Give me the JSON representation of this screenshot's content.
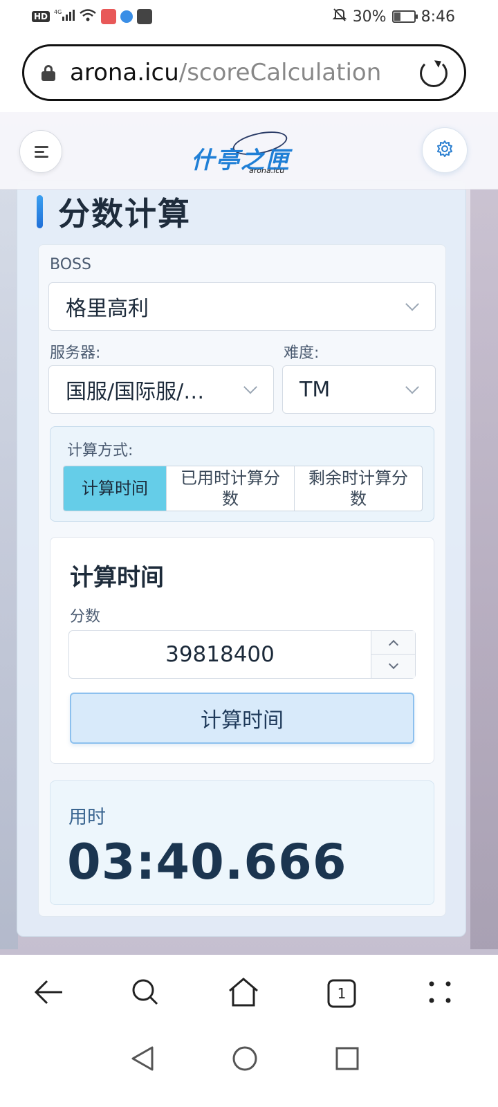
{
  "status_bar": {
    "hd": "HD",
    "signal": "4G",
    "battery": "30%",
    "time": "8:46"
  },
  "browser": {
    "url_host": "arona.icu",
    "url_path": "/scoreCalculation",
    "tab_count": "1"
  },
  "header": {
    "logo_text": "什亭之匣",
    "logo_sub": "arona.icu"
  },
  "page": {
    "title": "分数计算",
    "boss_label": "BOSS",
    "boss_value": "格里高利",
    "server_label": "服务器:",
    "server_value": "国服/国际服/…",
    "difficulty_label": "难度:",
    "difficulty_value": "TM",
    "method_label": "计算方式:",
    "methods": [
      {
        "label": "计算时间",
        "active": true
      },
      {
        "label": "已用时计算分数",
        "active": false
      },
      {
        "label": "剩余时计算分数",
        "active": false
      }
    ],
    "calc_title": "计算时间",
    "score_label": "分数",
    "score_value": "39818400",
    "calc_button": "计算时间",
    "result_label": "用时",
    "result_value": "03:40.666"
  },
  "colors": {
    "accent": "#65cde8",
    "brand": "#1f7fd6",
    "button_bg": "#d8eafa"
  }
}
